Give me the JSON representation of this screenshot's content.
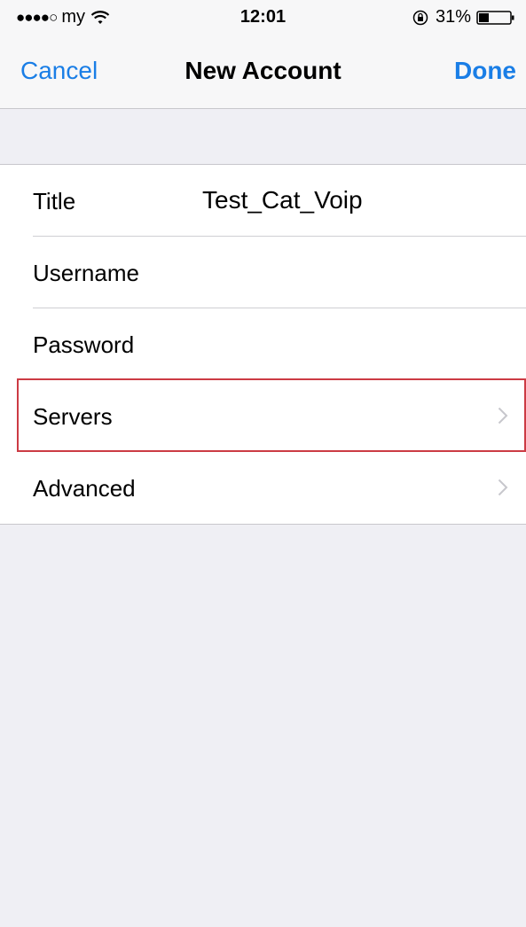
{
  "status_bar": {
    "signal": "●●●●○",
    "carrier": "my",
    "time": "12:01",
    "battery_percent": "31%",
    "battery_level": 0.31
  },
  "nav": {
    "cancel_label": "Cancel",
    "title": "New Account",
    "done_label": "Done"
  },
  "form": {
    "rows": [
      {
        "label": "Title",
        "value": "Test_Cat_Voip"
      },
      {
        "label": "Username",
        "value": ""
      },
      {
        "label": "Password",
        "value": ""
      },
      {
        "label": "Servers",
        "has_chevron": true,
        "highlighted": true
      },
      {
        "label": "Advanced",
        "has_chevron": true
      }
    ]
  },
  "colors": {
    "accent": "#1a7ee6",
    "highlight_border": "#cc3b44",
    "background": "#efeff4"
  }
}
